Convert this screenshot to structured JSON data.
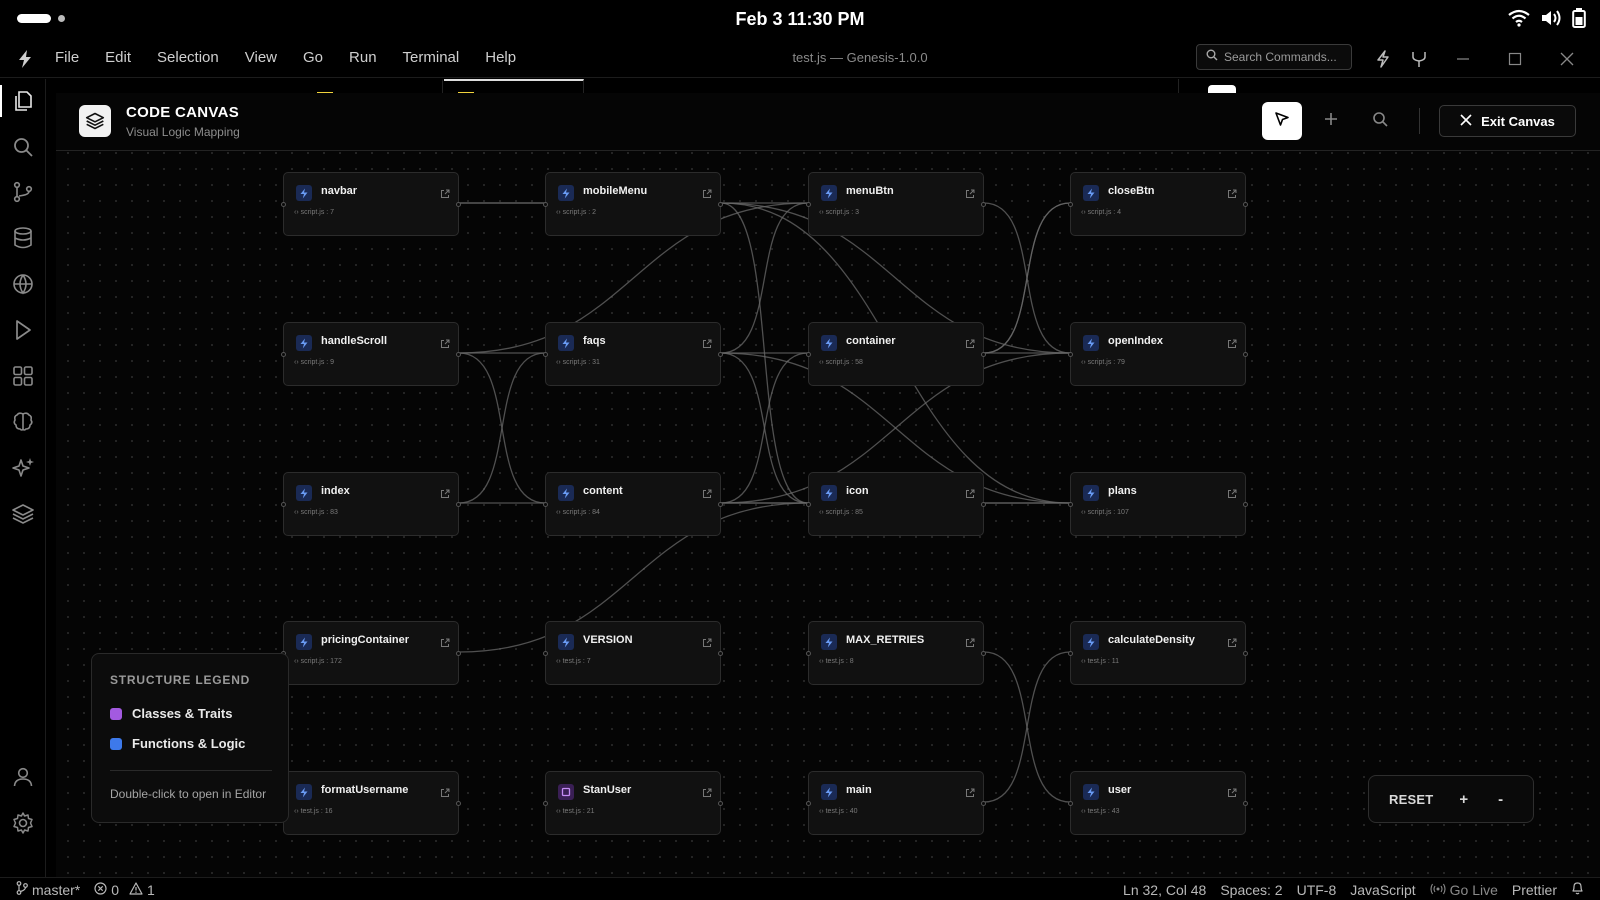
{
  "os": {
    "clock": "Feb 3  11:30 PM"
  },
  "menubar": {
    "items": [
      "File",
      "Edit",
      "Selection",
      "View",
      "Go",
      "Run",
      "Terminal",
      "Help"
    ],
    "window_title": "test.js — Genesis-1.0.0",
    "search_placeholder": "Search Commands..."
  },
  "canvas": {
    "title": "CODE CANVAS",
    "subtitle": "Visual Logic Mapping",
    "exit_label": "Exit Canvas"
  },
  "nodes": [
    {
      "name": "navbar",
      "loc": "script.js : 7",
      "kind": "function"
    },
    {
      "name": "mobileMenu",
      "loc": "script.js : 2",
      "kind": "function"
    },
    {
      "name": "menuBtn",
      "loc": "script.js : 3",
      "kind": "function"
    },
    {
      "name": "closeBtn",
      "loc": "script.js : 4",
      "kind": "function"
    },
    {
      "name": "handleScroll",
      "loc": "script.js : 9",
      "kind": "function"
    },
    {
      "name": "faqs",
      "loc": "script.js : 31",
      "kind": "function"
    },
    {
      "name": "container",
      "loc": "script.js : 58",
      "kind": "function"
    },
    {
      "name": "openIndex",
      "loc": "script.js : 79",
      "kind": "function"
    },
    {
      "name": "index",
      "loc": "script.js : 83",
      "kind": "function"
    },
    {
      "name": "content",
      "loc": "script.js : 84",
      "kind": "function"
    },
    {
      "name": "icon",
      "loc": "script.js : 85",
      "kind": "function"
    },
    {
      "name": "plans",
      "loc": "script.js : 107",
      "kind": "function"
    },
    {
      "name": "pricingContainer",
      "loc": "script.js : 172",
      "kind": "function"
    },
    {
      "name": "VERSION",
      "loc": "test.js : 7",
      "kind": "function"
    },
    {
      "name": "MAX_RETRIES",
      "loc": "test.js : 8",
      "kind": "function"
    },
    {
      "name": "calculateDensity",
      "loc": "test.js : 11",
      "kind": "function"
    },
    {
      "name": "formatUsername",
      "loc": "test.js : 16",
      "kind": "function"
    },
    {
      "name": "StanUser",
      "loc": "test.js : 21",
      "kind": "class"
    },
    {
      "name": "main",
      "loc": "test.js : 40",
      "kind": "function"
    },
    {
      "name": "user",
      "loc": "test.js : 43",
      "kind": "function"
    }
  ],
  "edges": [
    [
      "navbar",
      "mobileMenu"
    ],
    [
      "navbar",
      "menuBtn"
    ],
    [
      "mobileMenu",
      "icon"
    ],
    [
      "mobileMenu",
      "openIndex"
    ],
    [
      "mobileMenu",
      "plans"
    ],
    [
      "menuBtn",
      "handleScroll"
    ],
    [
      "menuBtn",
      "faqs"
    ],
    [
      "menuBtn",
      "openIndex"
    ],
    [
      "closeBtn",
      "container"
    ],
    [
      "closeBtn",
      "container"
    ],
    [
      "handleScroll",
      "container"
    ],
    [
      "handleScroll",
      "content"
    ],
    [
      "faqs",
      "icon"
    ],
    [
      "faqs",
      "plans"
    ],
    [
      "index",
      "faqs"
    ],
    [
      "index",
      "content"
    ],
    [
      "content",
      "container"
    ],
    [
      "content",
      "openIndex"
    ],
    [
      "content",
      "icon"
    ],
    [
      "content",
      "plans"
    ],
    [
      "pricingContainer",
      "icon"
    ],
    [
      "MAX_RETRIES",
      "user"
    ],
    [
      "calculateDensity",
      "main"
    ],
    [
      "container",
      "openIndex"
    ],
    [
      "icon",
      "plans"
    ]
  ],
  "legend": {
    "title": "STRUCTURE LEGEND",
    "items": [
      {
        "label": "Classes & Traits",
        "color": "#a35ae0"
      },
      {
        "label": "Functions & Logic",
        "color": "#3d79ea"
      }
    ],
    "hint": "Double-click to open in Editor"
  },
  "zoom": {
    "reset": "RESET",
    "plus": "+",
    "minus": "-"
  },
  "statusbar": {
    "branch": "master*",
    "errors": "0",
    "warnings": "1",
    "position": "Ln 32, Col 48",
    "spaces": "Spaces: 2",
    "encoding": "UTF-8",
    "language": "JavaScript",
    "golive": "Go Live",
    "formatter": "Prettier"
  },
  "colors": {
    "function_icon": "#3d79ea",
    "class_icon": "#a35ae0",
    "edge": "#6a6a6a"
  }
}
